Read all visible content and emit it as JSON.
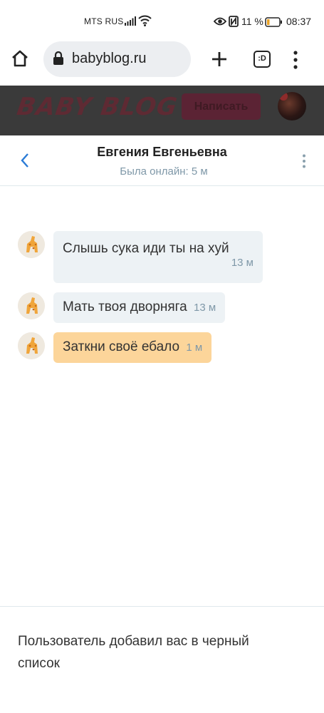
{
  "status_bar": {
    "carrier": "MTS RUS",
    "battery_percent": "11 %",
    "time": "08:37",
    "icons": [
      "signal-icon",
      "wifi-icon",
      "eye-icon",
      "nfc-icon",
      "battery-icon"
    ]
  },
  "browser": {
    "url": "babyblog.ru",
    "tabs_label": ":D"
  },
  "site_header": {
    "logo": "BABY BLOG",
    "write_button": "Написать"
  },
  "chat": {
    "name": "Евгения Евгеньевна",
    "status": "Была онлайн: 5 м"
  },
  "messages": [
    {
      "text": "Слышь сука иди ты на хуй",
      "time": "13 м",
      "highlighted": false
    },
    {
      "text": "Мать твоя дворняга",
      "time": "13 м",
      "highlighted": false
    },
    {
      "text": "Заткни своё ебало",
      "time": "1 м",
      "highlighted": true
    }
  ],
  "footer": {
    "notice": "Пользователь добавил вас в черный список"
  },
  "colors": {
    "bubble": "#edf2f5",
    "bubble_highlight": "#fcd59a",
    "muted": "#7f98a8",
    "accent_blue": "#2a7bd6",
    "header_bg": "#3a3a3a"
  }
}
